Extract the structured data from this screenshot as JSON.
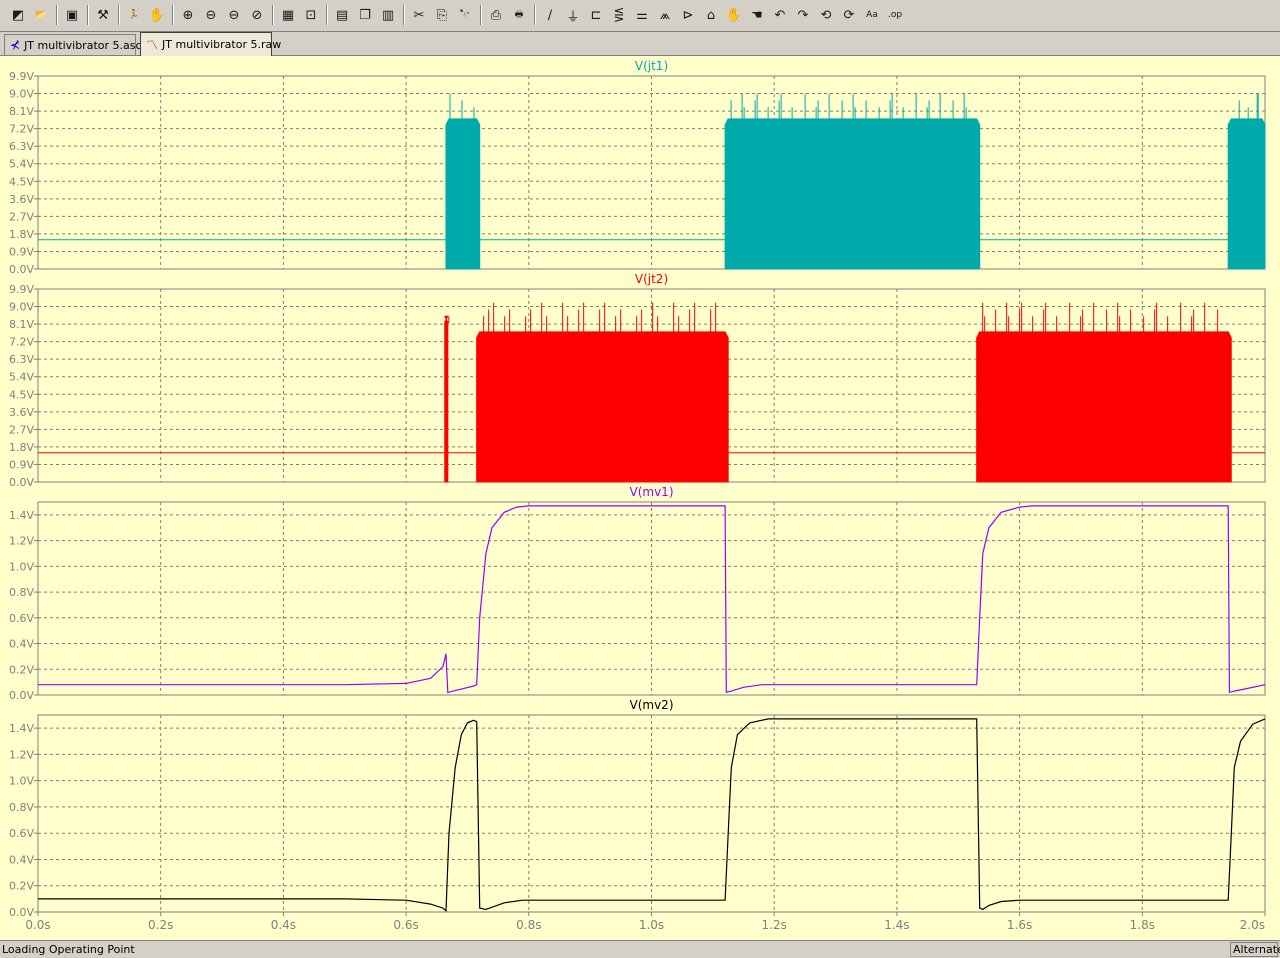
{
  "toolbar": {
    "buttons": [
      {
        "name": "new-schematic-icon",
        "glyph": "◩",
        "group": 0
      },
      {
        "name": "open-folder-icon",
        "glyph": "📂",
        "group": 0
      },
      {
        "name": "save-icon",
        "glyph": "▣",
        "group": 1
      },
      {
        "name": "control-panel-icon",
        "glyph": "⚒",
        "group": 2
      },
      {
        "name": "run-icon",
        "glyph": "🏃",
        "group": 3
      },
      {
        "name": "pan-hand-icon",
        "glyph": "✋",
        "group": 3
      },
      {
        "name": "zoom-in-icon",
        "glyph": "⊕",
        "group": 4
      },
      {
        "name": "zoom-out-icon",
        "glyph": "⊖",
        "group": 4
      },
      {
        "name": "zoom-area-icon",
        "glyph": "⊖",
        "group": 4
      },
      {
        "name": "zoom-cancel-icon",
        "glyph": "⊘",
        "group": 4
      },
      {
        "name": "autorange-icon",
        "glyph": "▦",
        "group": 5
      },
      {
        "name": "fit-icon",
        "glyph": "⊡",
        "group": 5
      },
      {
        "name": "tile-horizontal-icon",
        "glyph": "▤",
        "group": 6
      },
      {
        "name": "cascade-icon",
        "glyph": "❐",
        "group": 6
      },
      {
        "name": "tile-vertical-icon",
        "glyph": "▥",
        "group": 6
      },
      {
        "name": "cut-icon",
        "glyph": "✂",
        "group": 7
      },
      {
        "name": "copy-icon",
        "glyph": "⎘",
        "group": 7
      },
      {
        "name": "find-icon",
        "glyph": "🔭",
        "group": 7
      },
      {
        "name": "print-preview-icon",
        "glyph": "⎙",
        "group": 8
      },
      {
        "name": "print-icon",
        "glyph": "🖶",
        "group": 8
      },
      {
        "name": "wire-icon",
        "glyph": "∕",
        "group": 9
      },
      {
        "name": "ground-icon",
        "glyph": "⏚",
        "group": 9
      },
      {
        "name": "label-icon",
        "glyph": "⊏",
        "group": 9
      },
      {
        "name": "resistor-icon",
        "glyph": "⋚",
        "group": 9
      },
      {
        "name": "capacitor-icon",
        "glyph": "⚌",
        "group": 9
      },
      {
        "name": "inductor-icon",
        "glyph": "⩕",
        "group": 9
      },
      {
        "name": "diode-icon",
        "glyph": "⊳",
        "group": 9
      },
      {
        "name": "component-icon",
        "glyph": "⌂",
        "group": 9
      },
      {
        "name": "move-hand-icon",
        "glyph": "✋",
        "group": 9
      },
      {
        "name": "drag-hand-icon",
        "glyph": "☚",
        "group": 9
      },
      {
        "name": "undo-icon",
        "glyph": "↶",
        "group": 9
      },
      {
        "name": "redo-icon",
        "glyph": "↷",
        "group": 9
      },
      {
        "name": "rotate-icon",
        "glyph": "⟲",
        "group": 9
      },
      {
        "name": "mirror-icon",
        "glyph": "⟳",
        "group": 9
      },
      {
        "name": "text-icon",
        "glyph": "Aa",
        "group": 9
      },
      {
        "name": "spice-directive-icon",
        "glyph": ".op",
        "group": 9
      }
    ]
  },
  "tabs": [
    {
      "label": "JT multivibrator 5.asc",
      "icon": "schematic-tab-icon",
      "active": false
    },
    {
      "label": "JT multivibrator 5.raw",
      "icon": "waveform-tab-icon",
      "active": true
    }
  ],
  "plot": {
    "background": "#ffffcc",
    "grid_color": "#7f7f7f",
    "axis_label_color": "#808080",
    "x_ticks": [
      "0.0s",
      "0.2s",
      "0.4s",
      "0.6s",
      "0.8s",
      "1.0s",
      "1.2s",
      "1.4s",
      "1.6s",
      "1.8s",
      "2.0s"
    ],
    "xlim": [
      0,
      2.0
    ]
  },
  "chart_data": [
    {
      "type": "line",
      "title": "V(jt1)",
      "color": "#00aaaa",
      "ylim": [
        0,
        9.9
      ],
      "y_ticks": [
        "9.9V",
        "9.0V",
        "8.1V",
        "7.2V",
        "6.3V",
        "5.4V",
        "4.5V",
        "3.6V",
        "2.7V",
        "1.8V",
        "0.9V",
        "0.0V"
      ],
      "baseline": 1.5,
      "oscillation_bursts": [
        {
          "start": 0.665,
          "end": 0.72,
          "level": 7.7,
          "spike": 9.0
        },
        {
          "start": 1.12,
          "end": 1.535,
          "level": 7.7,
          "spike": 9.0
        },
        {
          "start": 1.94,
          "end": 2.0,
          "level": 7.7,
          "spike": 9.0
        }
      ]
    },
    {
      "type": "line",
      "title": "V(jt2)",
      "color": "#ff0000",
      "ylim": [
        0,
        9.9
      ],
      "y_ticks": [
        "9.9V",
        "9.0V",
        "8.1V",
        "7.2V",
        "6.3V",
        "5.4V",
        "4.5V",
        "3.6V",
        "2.7V",
        "1.8V",
        "0.9V",
        "0.0V"
      ],
      "baseline": 1.5,
      "oscillation_bursts": [
        {
          "start": 0.663,
          "end": 0.668,
          "level": 8.5,
          "spike": 8.5
        },
        {
          "start": 0.715,
          "end": 1.125,
          "level": 7.7,
          "spike": 9.2
        },
        {
          "start": 1.53,
          "end": 1.945,
          "level": 7.7,
          "spike": 9.2
        }
      ]
    },
    {
      "type": "line",
      "title": "V(mv1)",
      "color": "#9900ff",
      "ylim": [
        0,
        1.5
      ],
      "y_ticks": [
        "1.4V",
        "1.2V",
        "1.0V",
        "0.8V",
        "0.6V",
        "0.4V",
        "0.2V",
        "0.0V"
      ],
      "x": [
        0,
        0.5,
        0.6,
        0.64,
        0.66,
        0.665,
        0.668,
        0.71,
        0.715,
        0.72,
        0.73,
        0.74,
        0.76,
        0.78,
        0.8,
        1.12,
        1.122,
        1.13,
        1.15,
        1.18,
        1.2,
        1.53,
        1.535,
        1.54,
        1.55,
        1.57,
        1.6,
        1.62,
        1.94,
        1.942,
        1.95,
        1.97,
        2.0
      ],
      "y": [
        0.08,
        0.08,
        0.09,
        0.13,
        0.22,
        0.32,
        0.02,
        0.07,
        0.08,
        0.6,
        1.1,
        1.3,
        1.42,
        1.46,
        1.47,
        1.47,
        0.02,
        0.03,
        0.06,
        0.08,
        0.08,
        0.08,
        0.6,
        1.1,
        1.3,
        1.42,
        1.46,
        1.47,
        1.47,
        0.02,
        0.03,
        0.05,
        0.08
      ]
    },
    {
      "type": "line",
      "title": "V(mv2)",
      "color": "#000000",
      "ylim": [
        0,
        1.5
      ],
      "y_ticks": [
        "1.4V",
        "1.2V",
        "1.0V",
        "0.8V",
        "0.6V",
        "0.4V",
        "0.2V",
        "0.0V"
      ],
      "x": [
        0,
        0.5,
        0.6,
        0.64,
        0.66,
        0.665,
        0.67,
        0.68,
        0.69,
        0.7,
        0.71,
        0.715,
        0.72,
        0.73,
        0.76,
        0.79,
        1.12,
        1.125,
        1.13,
        1.14,
        1.16,
        1.19,
        1.21,
        1.53,
        1.535,
        1.54,
        1.55,
        1.57,
        1.6,
        1.94,
        1.945,
        1.95,
        1.96,
        1.98,
        2.0
      ],
      "y": [
        0.1,
        0.1,
        0.09,
        0.06,
        0.03,
        0.01,
        0.6,
        1.1,
        1.35,
        1.44,
        1.46,
        1.45,
        0.03,
        0.02,
        0.07,
        0.09,
        0.09,
        0.6,
        1.1,
        1.35,
        1.44,
        1.47,
        1.47,
        1.47,
        0.03,
        0.02,
        0.05,
        0.08,
        0.09,
        0.09,
        0.6,
        1.1,
        1.3,
        1.43,
        1.47
      ]
    }
  ],
  "status": {
    "left": "Loading Operating Point",
    "right": "Alternate"
  }
}
